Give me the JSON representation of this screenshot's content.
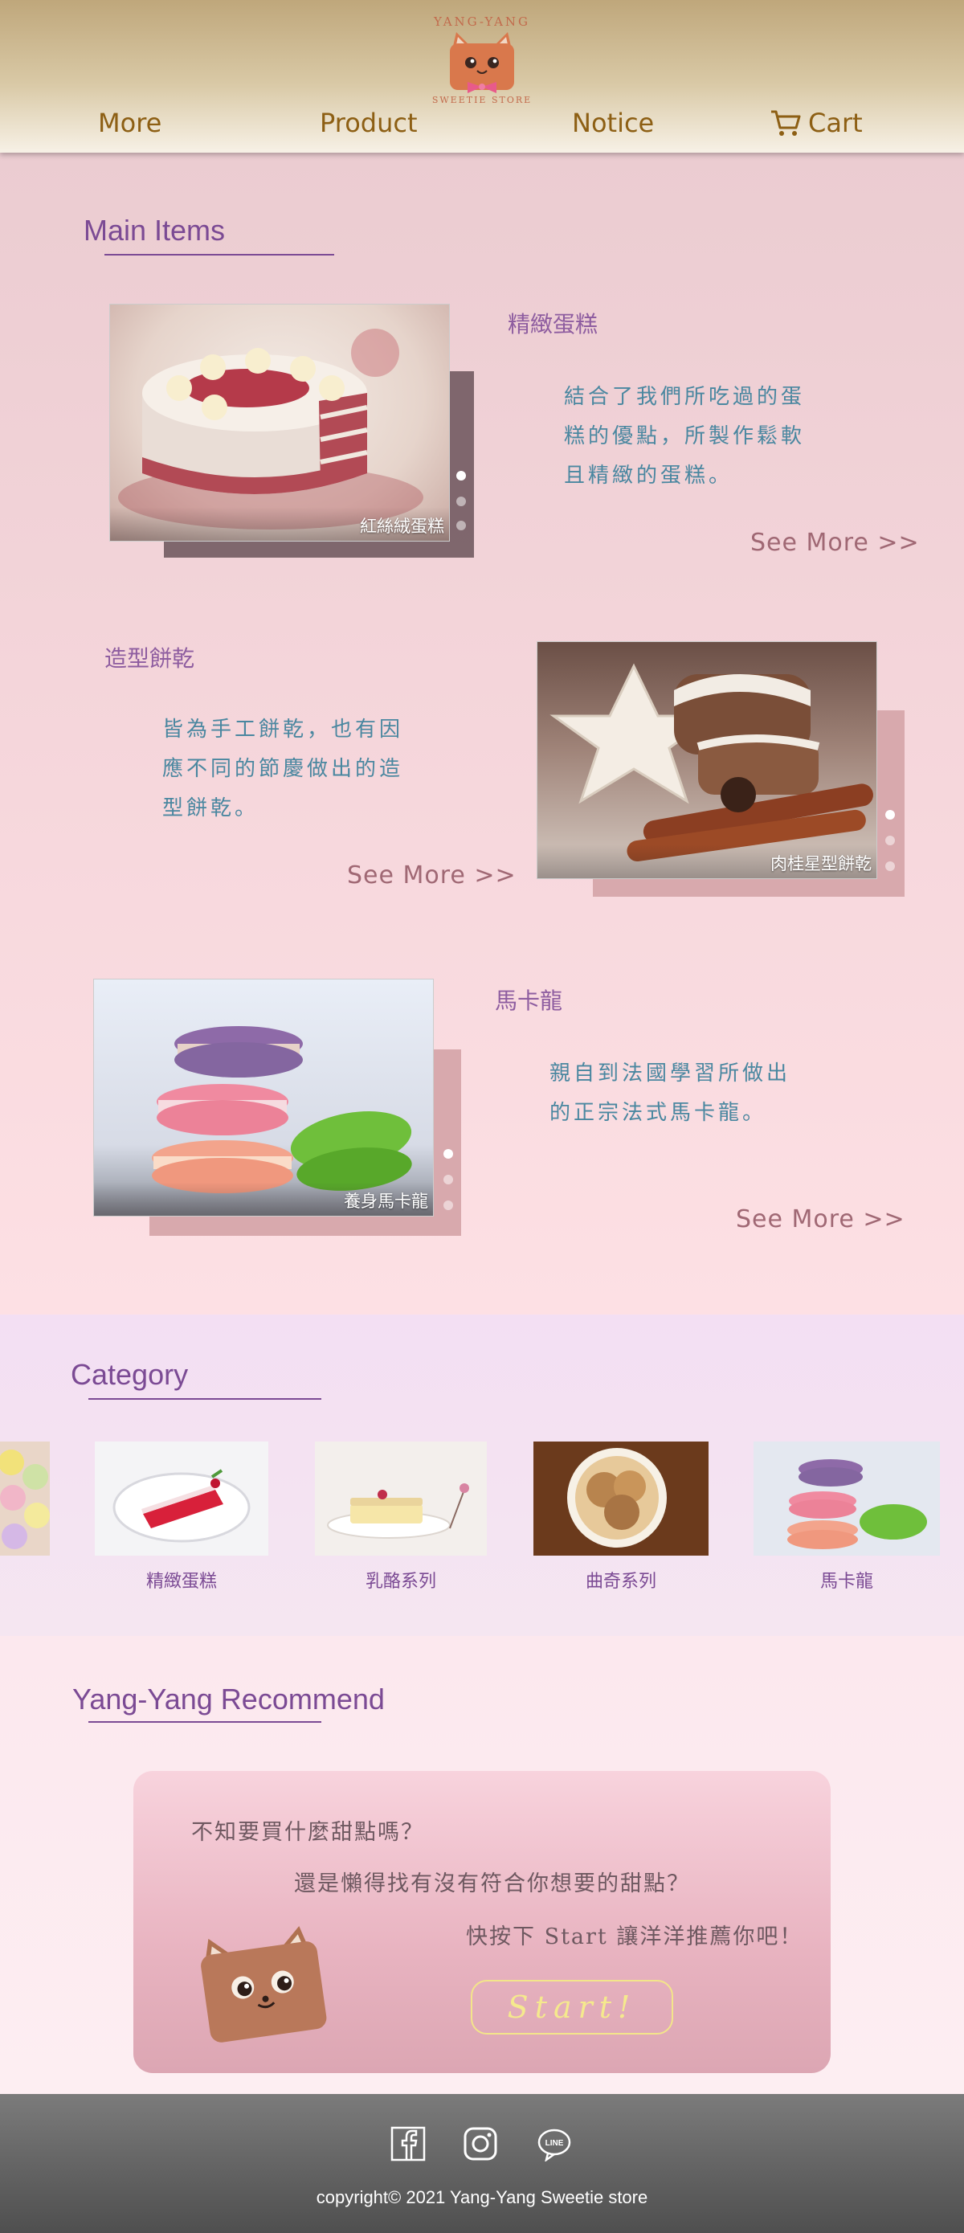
{
  "header": {
    "logo_top": "YANG-YANG",
    "logo_bottom": "SWEETIE STORE",
    "nav": {
      "more": "More",
      "product": "Product",
      "notice": "Notice",
      "cart": "Cart"
    }
  },
  "main_items": {
    "title": "Main Items",
    "items": [
      {
        "title": "精緻蛋糕",
        "desc_lines": [
          "結合了我們所吃過的蛋",
          "糕的優點，所製作鬆軟",
          "且精緻的蛋糕。"
        ],
        "caption": "紅絲絨蛋糕",
        "see_more": "See More >>"
      },
      {
        "title": "造型餅乾",
        "desc_lines": [
          "皆為手工餅乾，也有因",
          "應不同的節慶做出的造",
          "型餅乾。"
        ],
        "caption": "肉桂星型餅乾",
        "see_more": "See More >>"
      },
      {
        "title": "馬卡龍",
        "desc_lines": [
          "親自到法國學習所做出",
          "的正宗法式馬卡龍。"
        ],
        "caption": "養身馬卡龍",
        "see_more": "See More >>"
      }
    ]
  },
  "category": {
    "title": "Category",
    "items": [
      {
        "label": "精緻蛋糕"
      },
      {
        "label": "乳酪系列"
      },
      {
        "label": "曲奇系列"
      },
      {
        "label": "馬卡龍"
      }
    ]
  },
  "recommend": {
    "title": "Yang-Yang Recommend",
    "line1": "不知要買什麼甜點嗎？",
    "line2": "還是懶得找有沒有符合你想要的甜點？",
    "line3": "快按下 Start 讓洋洋推薦你吧！",
    "start_label": "Start!"
  },
  "footer": {
    "copyright": "copyright© 2021 Yang-Yang Sweetie store"
  },
  "colors": {
    "nav_text": "#8d5f14",
    "accent_purple": "#7b4a94",
    "desc_teal": "#4a87a0",
    "see_more": "#a06874",
    "start_yellow": "#f5e98d"
  }
}
